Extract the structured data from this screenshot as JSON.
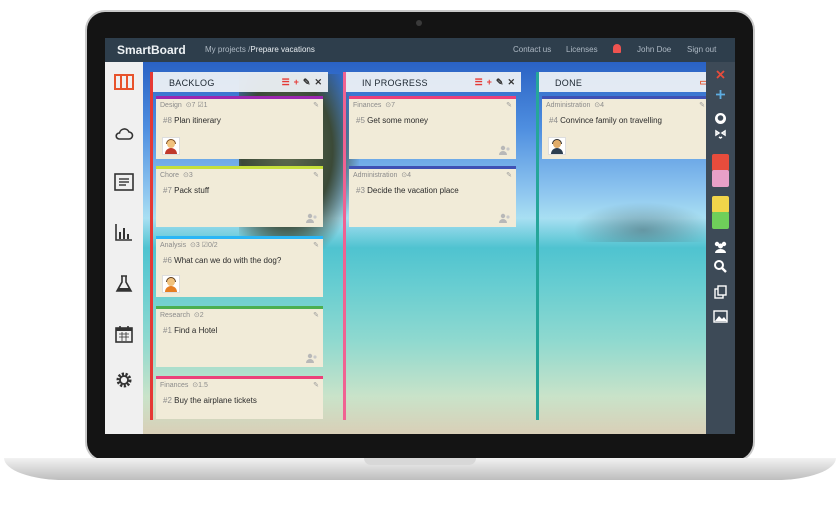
{
  "app": {
    "title": "SmartBoard",
    "breadcrumb_parent": "My projects",
    "breadcrumb_sep": " /",
    "breadcrumb_current": "Prepare vacations"
  },
  "nav": {
    "contact": "Contact us",
    "licenses": "Licenses",
    "user": "John Doe",
    "signout": "Sign out"
  },
  "left_icons": [
    "board-icon",
    "cloud-icon",
    "list-icon",
    "chart-icon",
    "flask-icon",
    "calendar-icon",
    "gear-icon"
  ],
  "right_icons": [
    "close-icon",
    "add-icon",
    "github-icon",
    "dropbox-icon",
    "calendar-red-icon",
    "calendar-pink-icon",
    "calendar-yellow-icon",
    "calendar-green-icon",
    "users-icon",
    "search-icon",
    "copy-icon",
    "image-icon"
  ],
  "columns": [
    {
      "title": "BACKLOG",
      "color": "#e53935",
      "cards": [
        {
          "category": "Design",
          "meta": "⊙7  ☑1",
          "num": "#8",
          "title": "Plan itinerary",
          "color": "#9c27b0",
          "avatar": "female"
        },
        {
          "category": "Chore",
          "meta": "⊙3",
          "num": "#7",
          "title": "Pack stuff",
          "color": "#c6e03a",
          "avatar": ""
        },
        {
          "category": "Analysis",
          "meta": "⊙3  ☑0/2",
          "num": "#6",
          "title": "What can we do with the dog?",
          "color": "#29b6f6",
          "avatar": "male"
        },
        {
          "category": "Research",
          "meta": "⊙2",
          "num": "#1",
          "title": "Find a Hotel",
          "color": "#4caf50",
          "avatar": ""
        },
        {
          "category": "Finances",
          "meta": "⊙1.5",
          "num": "#2",
          "title": "Buy the airplane tickets",
          "color": "#ec407a",
          "avatar": ""
        }
      ]
    },
    {
      "title": "IN PROGRESS",
      "color": "#f06292",
      "cards": [
        {
          "category": "Finances",
          "meta": "⊙7",
          "num": "#5",
          "title": "Get some money",
          "color": "#ec407a",
          "avatar": ""
        },
        {
          "category": "Administration",
          "meta": "⊙4",
          "num": "#3",
          "title": "Decide the vacation place",
          "color": "#3f51b5",
          "avatar": ""
        }
      ]
    },
    {
      "title": "DONE",
      "color": "#26a69a",
      "cards": [
        {
          "category": "Administration",
          "meta": "⊙4",
          "num": "#4",
          "title": "Convince family on travelling",
          "color": "#3f51b5",
          "avatar": "male2"
        }
      ]
    }
  ]
}
